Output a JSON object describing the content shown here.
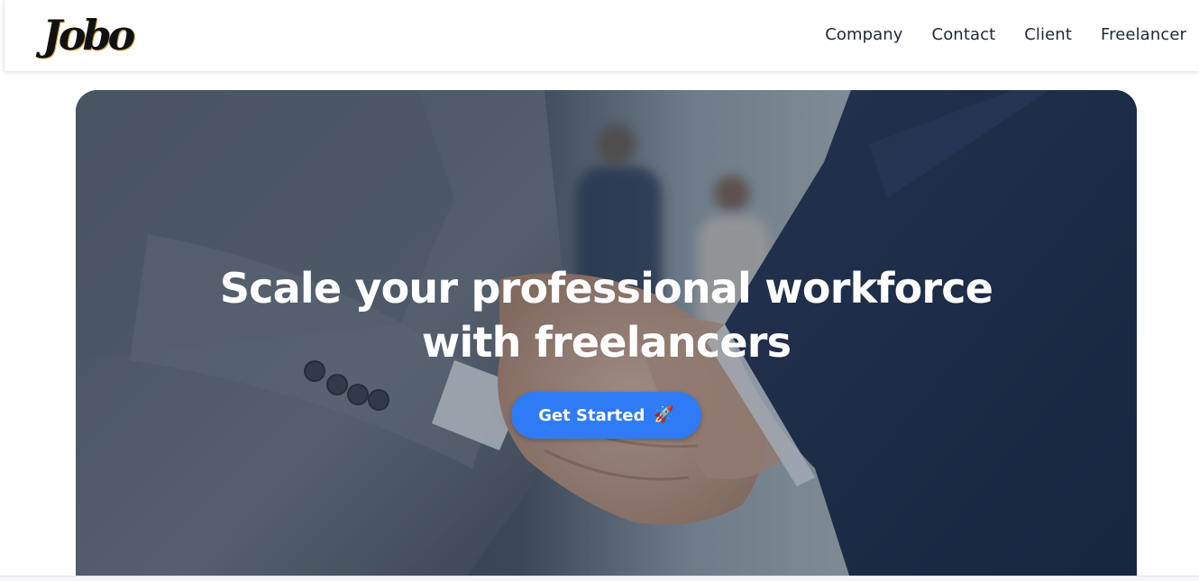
{
  "brand": {
    "logo_text": "Jobo"
  },
  "nav": {
    "items": [
      {
        "label": "Company"
      },
      {
        "label": "Contact"
      },
      {
        "label": "Client"
      },
      {
        "label": "Freelancer"
      }
    ]
  },
  "hero": {
    "title_line1": "Scale your professional workforce",
    "title_line2": "with freelancers",
    "cta_label": "Get Started",
    "cta_icon": "rocket-icon",
    "cta_emoji": "🚀",
    "image_subject": "business-handshake-photo"
  },
  "colors": {
    "accent": "#2f7bf5",
    "nav_text": "#1f2937",
    "hero_overlay": "#1e2a3d"
  }
}
